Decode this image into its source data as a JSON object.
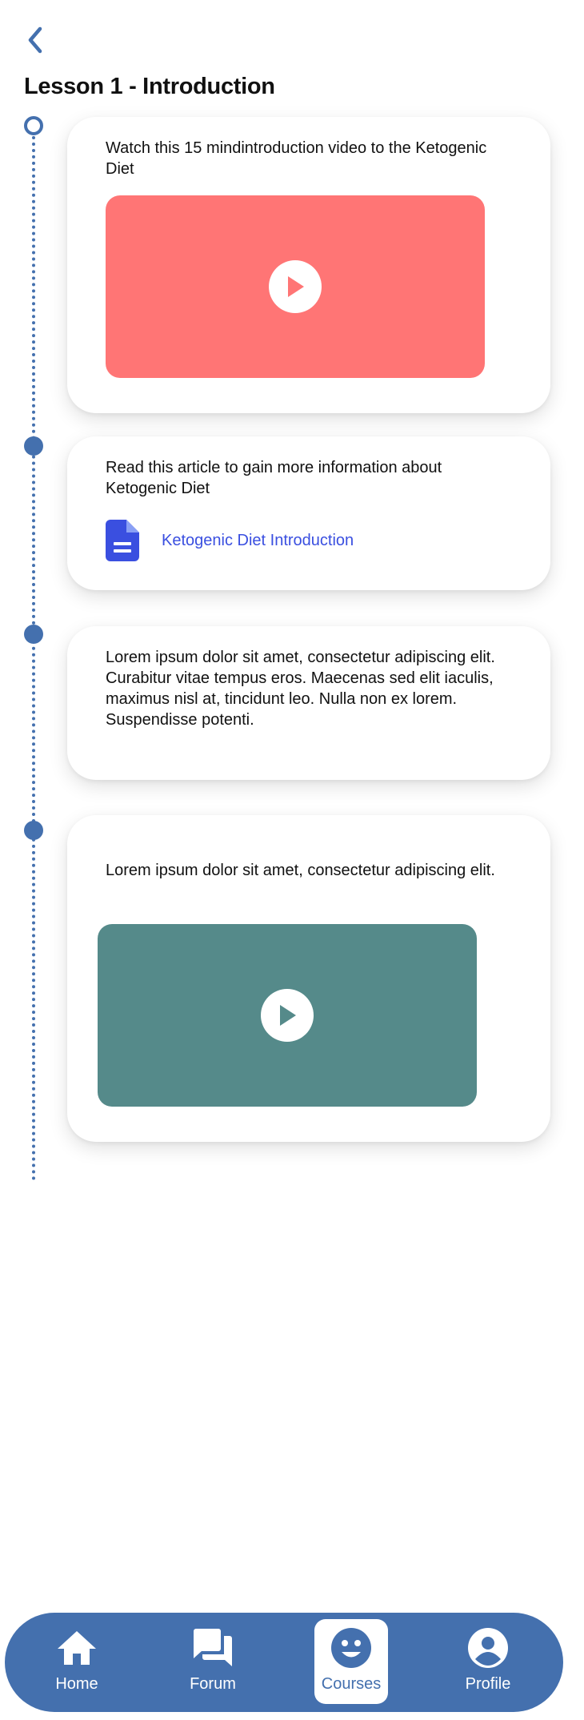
{
  "header": {
    "back_icon": "chevron-left-icon",
    "title": "Lesson 1 - Introduction"
  },
  "colors": {
    "accent": "#4470ae",
    "video1": "#ff7575",
    "video2": "#558a8a",
    "link": "#3a4fe0"
  },
  "timeline": {
    "items": [
      {
        "type": "video",
        "text": "Watch this 15 mindintroduction video to the Ketogenic Diet",
        "icon": "play-icon"
      },
      {
        "type": "article",
        "text": "Read this article to gain more information about Ketogenic Diet",
        "icon": "document-icon",
        "link_label": "Ketogenic Diet Introduction"
      },
      {
        "type": "text",
        "text": "Lorem ipsum dolor sit amet, consectetur adipiscing elit. Curabitur vitae tempus eros. Maecenas sed elit iaculis, maximus nisl at, tincidunt leo. Nulla non ex lorem. Suspendisse potenti."
      },
      {
        "type": "video",
        "text": "Lorem ipsum dolor sit amet, consectetur adipiscing elit.",
        "icon": "play-icon"
      }
    ]
  },
  "nav": {
    "items": [
      {
        "label": "Home",
        "icon": "home-icon",
        "active": false
      },
      {
        "label": "Forum",
        "icon": "forum-icon",
        "active": false
      },
      {
        "label": "Courses",
        "icon": "smiley-icon",
        "active": true
      },
      {
        "label": "Profile",
        "icon": "profile-icon",
        "active": false
      }
    ]
  }
}
